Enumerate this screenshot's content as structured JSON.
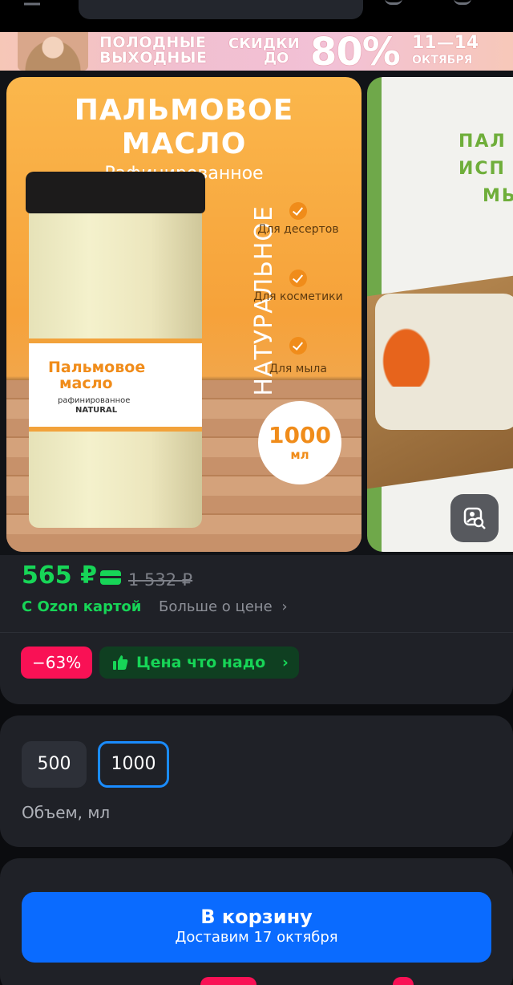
{
  "banner": {
    "line1": "ПОЛОДНЫЕ",
    "line2": "ВЫХОДНЫЕ",
    "sale1": "СКИДКИ",
    "sale2": "ДО",
    "sale_pct": "80%",
    "dates": "11—14",
    "month": "ОКТЯБРЯ"
  },
  "gallery": {
    "slide1": {
      "title1": "ПАЛЬМОВОЕ",
      "title2": "МАСЛО",
      "subtitle": "Рафинированное",
      "vertical": "НАТУРАЛЬНОЕ",
      "features": [
        "Для десертов",
        "Для косметики",
        "Для мыла"
      ],
      "volume_num": "1000",
      "volume_unit": "мл",
      "label_line1": "Пальмовое",
      "label_line2": "масло",
      "label_line3": "рафинированное",
      "label_line4": "NATURAL"
    },
    "slide2": {
      "lines": [
        "ПАЛ",
        "ИСП",
        "МЫ"
      ]
    },
    "lens_icon": "image-search-icon"
  },
  "price": {
    "current": "565 ₽",
    "old": "1 532 ₽",
    "ozon_card": "С Ozon картой",
    "more": "Больше о цене",
    "more_chevron": "›",
    "discount": "−63%",
    "good_price": "Цена что надо",
    "good_chevron": "›",
    "accent_green": "#17d557",
    "accent_pink": "#f91155"
  },
  "volume": {
    "options": [
      "500",
      "1000"
    ],
    "selected": "1000",
    "caption": "Объем, мл"
  },
  "cta": {
    "label": "В корзину",
    "delivery": "Доставим 17 октября",
    "color": "#0a6bff"
  }
}
